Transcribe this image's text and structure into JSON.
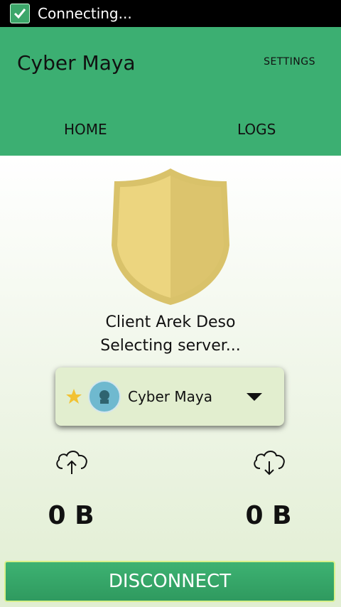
{
  "status_bar": {
    "text": "Connecting...",
    "icon": "check-icon"
  },
  "app_bar": {
    "title": "Cyber Maya",
    "settings_label": "SETTINGS",
    "tabs": [
      {
        "label": "HOME"
      },
      {
        "label": "LOGS"
      }
    ]
  },
  "main": {
    "client_name": "Client Arek Deso",
    "status_text": "Selecting server...",
    "server": {
      "name": "Cyber Maya",
      "favorite_icon": "star-icon",
      "logo_icon": "server-logo"
    },
    "upload": {
      "value": "0 B",
      "icon": "cloud-upload-icon"
    },
    "download": {
      "value": "0 B",
      "icon": "cloud-download-icon"
    },
    "disconnect_label": "DISCONNECT"
  },
  "colors": {
    "accent": "#3caf72",
    "shield": "#e8d37a"
  }
}
